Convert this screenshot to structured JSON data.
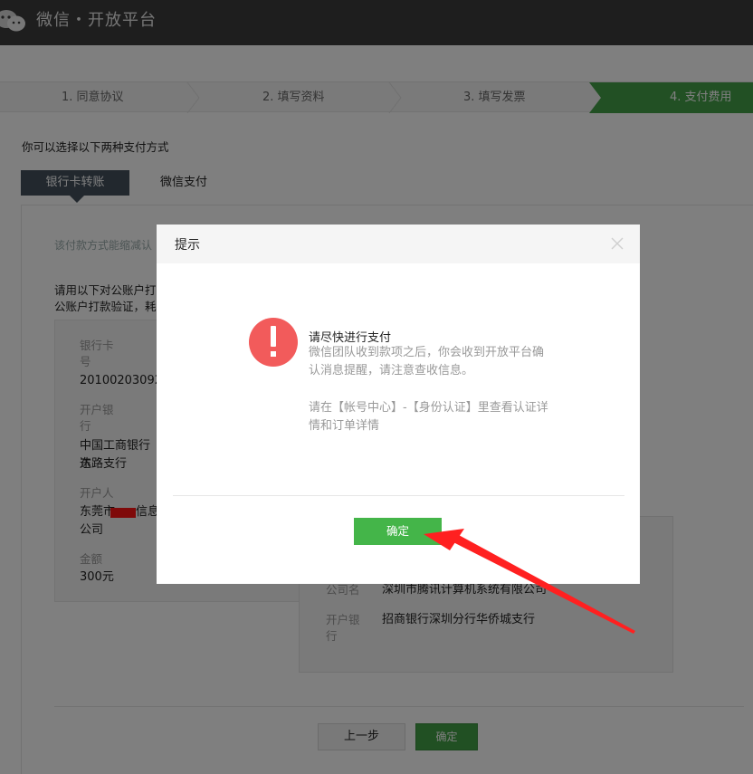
{
  "header": {
    "title": "微信・开放平台",
    "logo_icon": "wechat-logo-icon"
  },
  "steps": [
    {
      "label": "1. 同意协议",
      "active": false
    },
    {
      "label": "2. 填写资料",
      "active": false
    },
    {
      "label": "3. 填写发票",
      "active": false
    },
    {
      "label": "4. 支付费用",
      "active": true
    }
  ],
  "payment": {
    "intro": "你可以选择以下两种支付方式",
    "tabs": [
      {
        "label": "银行卡转账",
        "active": true
      },
      {
        "label": "微信支付",
        "active": false
      }
    ],
    "note_gray": "该付款方式能缩减认",
    "note_line1": "请用以下对公账户打",
    "note_line2": "公账户打款验证，耗"
  },
  "payer_account": {
    "card_label": "银行卡号",
    "card_label_line1": "银行卡",
    "card_label_line2": "号",
    "card_value": "20100203092",
    "bank_label_line1": "开户银",
    "bank_label_line2": "行",
    "bank_value_line1": "中国工商银行东",
    "bank_value_line2": "达路支行",
    "holder_label": "开户人",
    "holder_value_line1a": "东莞市",
    "holder_value_line1b": "信息",
    "holder_value_line2": "公司",
    "amount_label": "金额",
    "amount_value": "300元"
  },
  "payee_account": {
    "company_label": "公司名",
    "company_value": "深圳市腾讯计算机系统有限公司",
    "bank_label_line1": "开户银",
    "bank_label_line2": "行",
    "bank_value": "招商银行深圳分行华侨城支行"
  },
  "footer": {
    "prev_label": "上一步",
    "confirm_label": "确定"
  },
  "modal": {
    "title": "提示",
    "message_title": "请尽快进行支付",
    "message_body": "微信团队收到款项之后，你会收到开放平台确认消息提醒，请注意查收信息。",
    "message_hint": "请在【帐号中心】-【身份认证】里查看认证详情和订单详情",
    "ok_label": "确定"
  },
  "colors": {
    "accent_green": "#44b549",
    "alert_red": "#f25b5b",
    "annotation_red": "#ff2020",
    "topbar": "#3d3d3d"
  }
}
